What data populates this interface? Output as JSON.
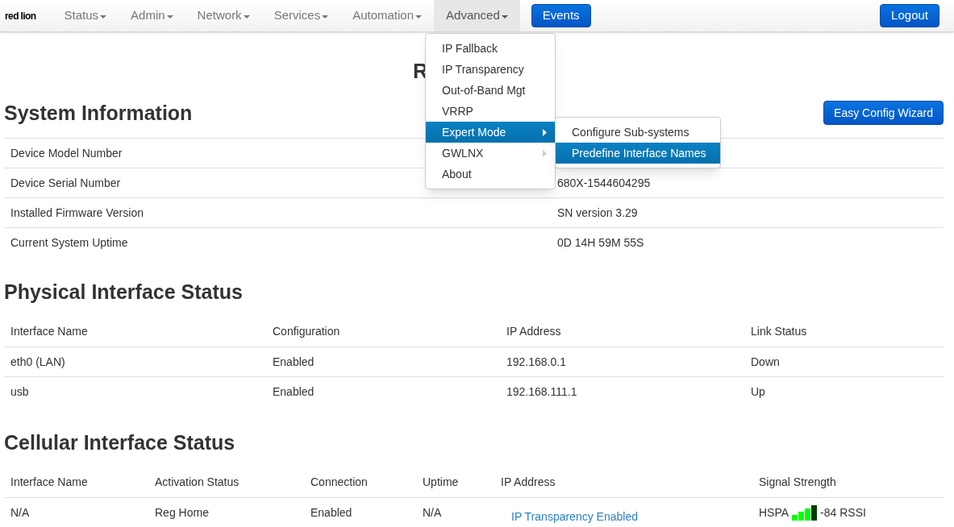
{
  "navbar": {
    "logo": "red lion",
    "menus": [
      {
        "label": "Status",
        "selected": false
      },
      {
        "label": "Admin",
        "selected": false
      },
      {
        "label": "Network",
        "selected": false
      },
      {
        "label": "Services",
        "selected": false
      },
      {
        "label": "Automation",
        "selected": false
      },
      {
        "label": "Advanced",
        "selected": true
      }
    ],
    "events_button": "Events",
    "logout_button": "Logout"
  },
  "dropdown": {
    "items": [
      {
        "label": "IP Fallback",
        "selected": false,
        "has_submenu": false
      },
      {
        "label": "IP Transparency",
        "selected": false,
        "has_submenu": false
      },
      {
        "label": "Out-of-Band Mgt",
        "selected": false,
        "has_submenu": false
      },
      {
        "label": "VRRP",
        "selected": false,
        "has_submenu": false
      },
      {
        "label": "Expert Mode",
        "selected": true,
        "has_submenu": true
      },
      {
        "label": "GWLNX",
        "selected": false,
        "has_submenu": true
      },
      {
        "label": "About",
        "selected": false,
        "has_submenu": false
      }
    ],
    "submenu": [
      {
        "label": "Configure Sub-systems",
        "selected": false
      },
      {
        "label": "Predefine Interface Names",
        "selected": true
      }
    ]
  },
  "page_title": "R",
  "system_information": {
    "title": "System Information",
    "wizard_button": "Easy Config Wizard",
    "rows": [
      {
        "label": "Device Model Number"
      },
      {
        "label": "Device Serial Number",
        "value": "680X-1544604295"
      },
      {
        "label": "Installed Firmware Version",
        "value": "SN version 3.29"
      },
      {
        "label": "Current System Uptime",
        "value": "0D 14H 59M 55S"
      }
    ]
  },
  "physical_interface_status": {
    "title": "Physical Interface Status",
    "columns": [
      "Interface Name",
      "Configuration",
      "IP Address",
      "Link Status"
    ],
    "rows": [
      [
        "eth0 (LAN)",
        "Enabled",
        "192.168.0.1",
        "Down"
      ],
      [
        "usb",
        "Enabled",
        "192.168.111.1",
        "Up"
      ]
    ]
  },
  "cellular_interface_status": {
    "title": "Cellular Interface Status",
    "columns": [
      "Interface Name",
      "Activation Status",
      "Connection",
      "Uptime",
      "IP Address",
      "Signal Strength"
    ],
    "rows": [
      {
        "interface_name": "N/A",
        "activation_status": "Reg Home",
        "connection": "Enabled",
        "uptime": "N/A",
        "ip_address_link": "IP Transparency Enabled",
        "signal_type": "HSPA",
        "signal_reading": "-84 RSSI"
      }
    ]
  }
}
